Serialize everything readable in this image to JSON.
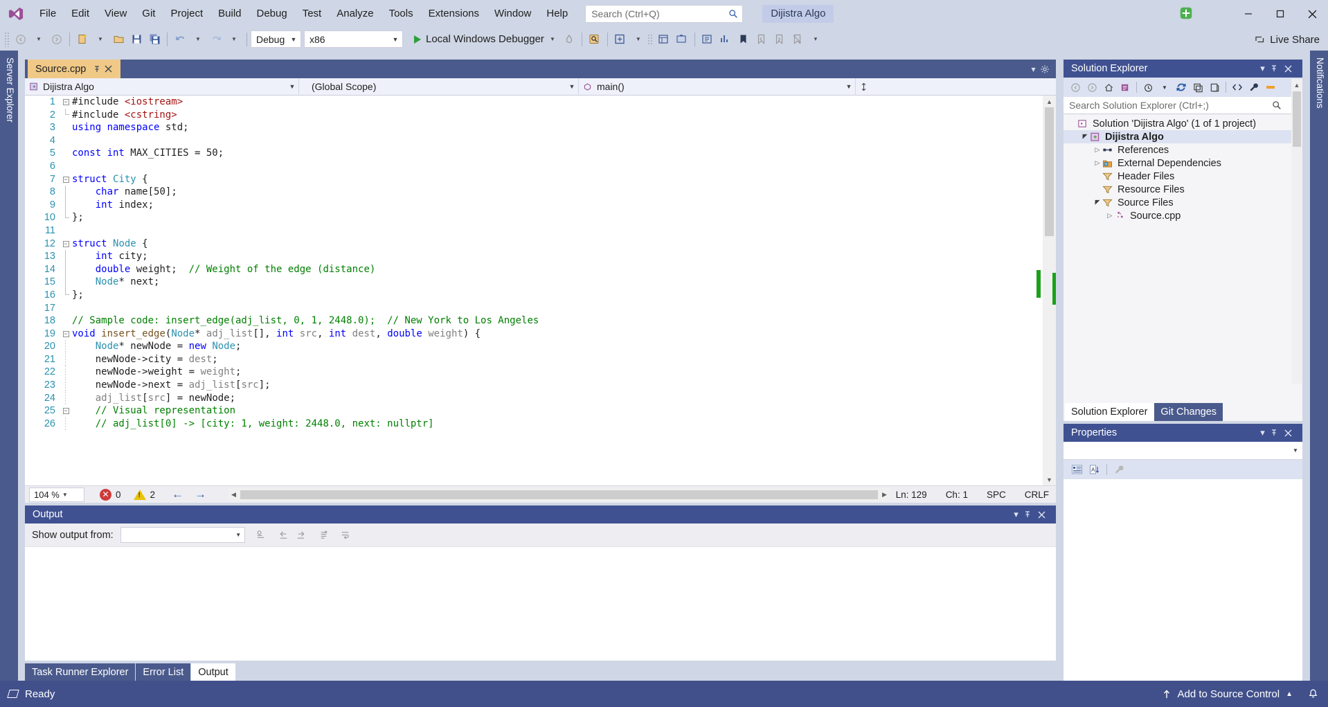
{
  "titlebar": {
    "logo_icon": "visual-studio-logo",
    "menu": [
      "File",
      "Edit",
      "View",
      "Git",
      "Project",
      "Build",
      "Debug",
      "Test",
      "Analyze",
      "Tools",
      "Extensions",
      "Window",
      "Help"
    ],
    "search_placeholder": "Search (Ctrl+Q)",
    "search_icon": "search-icon",
    "project_chip": "Dijistra Algo",
    "minimize_icon": "minimize-icon",
    "maximize_icon": "maximize-icon",
    "close_icon": "close-icon"
  },
  "toolbar": {
    "back_icon": "navigate-back-icon",
    "forward_icon": "navigate-forward-icon",
    "new_project_icon": "new-project-icon",
    "open_icon": "open-file-icon",
    "save_icon": "save-icon",
    "save_all_icon": "save-all-icon",
    "undo_icon": "undo-icon",
    "redo_icon": "redo-icon",
    "config_value": "Debug",
    "platform_value": "x86",
    "run_label": "Local Windows Debugger",
    "run_icon": "play-icon",
    "hot_reload_icon": "hot-reload-icon",
    "find_icon": "find-in-files-icon",
    "live_share_label": "Live Share",
    "live_share_icon": "live-share-icon"
  },
  "left_rail": {
    "label": "Server Explorer"
  },
  "right_rail": {
    "label": "Notifications"
  },
  "editor": {
    "tab_title": "Source.cpp",
    "pin_icon": "pin-icon",
    "close_icon": "close-icon",
    "nav_project": "Dijistra Algo",
    "nav_scope": "(Global Scope)",
    "nav_member": "main()",
    "nav_member_icon": "method-icon",
    "nav_project_icon": "cpp-project-icon",
    "lines": [
      {
        "n": 1,
        "fold": "minus",
        "indent": 0,
        "tokens": [
          {
            "t": "#include ",
            "c": "pp"
          },
          {
            "t": "<iostream>",
            "c": "str"
          }
        ]
      },
      {
        "n": 2,
        "fold": "end",
        "indent": 0,
        "tokens": [
          {
            "t": "#include ",
            "c": "pp"
          },
          {
            "t": "<cstring>",
            "c": "str"
          }
        ]
      },
      {
        "n": 3,
        "fold": "none",
        "indent": 0,
        "tokens": [
          {
            "t": "using ",
            "c": "kw"
          },
          {
            "t": "namespace ",
            "c": "kw"
          },
          {
            "t": "std;",
            "c": "num"
          }
        ]
      },
      {
        "n": 4,
        "fold": "none",
        "indent": 0,
        "tokens": []
      },
      {
        "n": 5,
        "fold": "none",
        "indent": 0,
        "tokens": [
          {
            "t": "const ",
            "c": "kw"
          },
          {
            "t": "int ",
            "c": "kw"
          },
          {
            "t": "MAX_CITIES = ",
            "c": "num"
          },
          {
            "t": "50",
            "c": "num"
          },
          {
            "t": ";",
            "c": "num"
          }
        ]
      },
      {
        "n": 6,
        "fold": "none",
        "indent": 0,
        "tokens": []
      },
      {
        "n": 7,
        "fold": "minus",
        "indent": 0,
        "tokens": [
          {
            "t": "struct ",
            "c": "kw"
          },
          {
            "t": "City",
            "c": "typ"
          },
          {
            "t": " {",
            "c": "num"
          }
        ]
      },
      {
        "n": 8,
        "fold": "bar",
        "indent": 0,
        "tokens": [
          {
            "t": "    ",
            "c": "num"
          },
          {
            "t": "char ",
            "c": "kw"
          },
          {
            "t": "name[",
            "c": "num"
          },
          {
            "t": "50",
            "c": "num"
          },
          {
            "t": "];",
            "c": "num"
          }
        ]
      },
      {
        "n": 9,
        "fold": "bar",
        "indent": 0,
        "tokens": [
          {
            "t": "    ",
            "c": "num"
          },
          {
            "t": "int ",
            "c": "kw"
          },
          {
            "t": "index;",
            "c": "num"
          }
        ]
      },
      {
        "n": 10,
        "fold": "endbar",
        "indent": 0,
        "tokens": [
          {
            "t": "};",
            "c": "num"
          }
        ]
      },
      {
        "n": 11,
        "fold": "none",
        "indent": 0,
        "tokens": []
      },
      {
        "n": 12,
        "fold": "minus",
        "indent": 0,
        "tokens": [
          {
            "t": "struct ",
            "c": "kw"
          },
          {
            "t": "Node",
            "c": "typ"
          },
          {
            "t": " {",
            "c": "num"
          }
        ]
      },
      {
        "n": 13,
        "fold": "bar",
        "indent": 0,
        "tokens": [
          {
            "t": "    ",
            "c": "num"
          },
          {
            "t": "int ",
            "c": "kw"
          },
          {
            "t": "city;",
            "c": "num"
          }
        ]
      },
      {
        "n": 14,
        "fold": "bar",
        "indent": 0,
        "tokens": [
          {
            "t": "    ",
            "c": "num"
          },
          {
            "t": "double ",
            "c": "kw"
          },
          {
            "t": "weight;  ",
            "c": "num"
          },
          {
            "t": "// Weight of the edge (distance)",
            "c": "cmt"
          }
        ]
      },
      {
        "n": 15,
        "fold": "bar",
        "indent": 0,
        "tokens": [
          {
            "t": "    ",
            "c": "num"
          },
          {
            "t": "Node",
            "c": "typ"
          },
          {
            "t": "* next;",
            "c": "num"
          }
        ]
      },
      {
        "n": 16,
        "fold": "endbar",
        "indent": 0,
        "tokens": [
          {
            "t": "};",
            "c": "num"
          }
        ]
      },
      {
        "n": 17,
        "fold": "none",
        "indent": 0,
        "tokens": []
      },
      {
        "n": 18,
        "fold": "none",
        "indent": 0,
        "tokens": [
          {
            "t": "// Sample code: insert_edge(adj_list, 0, 1, 2448.0);  // New York to Los Angeles",
            "c": "cmt"
          }
        ]
      },
      {
        "n": 19,
        "fold": "minus",
        "indent": 0,
        "tokens": [
          {
            "t": "void ",
            "c": "kw"
          },
          {
            "t": "insert_edge",
            "c": "fn"
          },
          {
            "t": "(",
            "c": "num"
          },
          {
            "t": "Node",
            "c": "typ"
          },
          {
            "t": "* ",
            "c": "num"
          },
          {
            "t": "adj_list",
            "c": "var"
          },
          {
            "t": "[], ",
            "c": "num"
          },
          {
            "t": "int ",
            "c": "kw"
          },
          {
            "t": "src",
            "c": "var"
          },
          {
            "t": ", ",
            "c": "num"
          },
          {
            "t": "int ",
            "c": "kw"
          },
          {
            "t": "dest",
            "c": "var"
          },
          {
            "t": ", ",
            "c": "num"
          },
          {
            "t": "double ",
            "c": "kw"
          },
          {
            "t": "weight",
            "c": "var"
          },
          {
            "t": ") {",
            "c": "num"
          }
        ]
      },
      {
        "n": 20,
        "fold": "ibar",
        "indent": 0,
        "tokens": [
          {
            "t": "    ",
            "c": "num"
          },
          {
            "t": "Node",
            "c": "typ"
          },
          {
            "t": "* newNode = ",
            "c": "num"
          },
          {
            "t": "new ",
            "c": "kw"
          },
          {
            "t": "Node",
            "c": "typ"
          },
          {
            "t": ";",
            "c": "num"
          }
        ]
      },
      {
        "n": 21,
        "fold": "ibar",
        "indent": 0,
        "tokens": [
          {
            "t": "    newNode->city = ",
            "c": "num"
          },
          {
            "t": "dest",
            "c": "var"
          },
          {
            "t": ";",
            "c": "num"
          }
        ]
      },
      {
        "n": 22,
        "fold": "ibar",
        "indent": 0,
        "tokens": [
          {
            "t": "    newNode->weight = ",
            "c": "num"
          },
          {
            "t": "weight",
            "c": "var"
          },
          {
            "t": ";",
            "c": "num"
          }
        ]
      },
      {
        "n": 23,
        "fold": "ibar",
        "indent": 0,
        "tokens": [
          {
            "t": "    newNode->next = ",
            "c": "num"
          },
          {
            "t": "adj_list",
            "c": "var"
          },
          {
            "t": "[",
            "c": "num"
          },
          {
            "t": "src",
            "c": "var"
          },
          {
            "t": "];",
            "c": "num"
          }
        ]
      },
      {
        "n": 24,
        "fold": "ibar",
        "indent": 0,
        "tokens": [
          {
            "t": "    ",
            "c": "num"
          },
          {
            "t": "adj_list",
            "c": "var"
          },
          {
            "t": "[",
            "c": "num"
          },
          {
            "t": "src",
            "c": "var"
          },
          {
            "t": "] = newNode;",
            "c": "num"
          }
        ]
      },
      {
        "n": 25,
        "fold": "minus2",
        "indent": 0,
        "tokens": [
          {
            "t": "    ",
            "c": "num"
          },
          {
            "t": "// Visual representation",
            "c": "cmt"
          }
        ]
      },
      {
        "n": 26,
        "fold": "ibar",
        "indent": 0,
        "tokens": [
          {
            "t": "    ",
            "c": "num"
          },
          {
            "t": "// adj_list[0] -> [city: 1, weight: 2448.0, next: nullptr]",
            "c": "cmt"
          }
        ]
      }
    ],
    "status": {
      "zoom": "104 %",
      "errors": "0",
      "warnings": "2",
      "error_icon": "error-icon",
      "warning_icon": "warning-icon",
      "prev_icon": "previous-error-icon",
      "next_icon": "next-error-icon",
      "line": "Ln: 129",
      "col": "Ch: 1",
      "spaces": "SPC",
      "eol": "CRLF"
    }
  },
  "output_panel": {
    "title": "Output",
    "show_from_label": "Show output from:",
    "show_from_value": "",
    "dropdown_icon": "chevron-down-icon",
    "find_icon": "find-message-icon",
    "prev_icon": "go-to-previous-icon",
    "next_icon": "go-to-next-icon",
    "clear_icon": "clear-all-icon",
    "wrap_icon": "toggle-word-wrap-icon",
    "minimize_icon": "window-menu-icon",
    "pin_icon": "pin-icon",
    "close_icon": "close-icon"
  },
  "bottom_tabs": [
    {
      "label": "Task Runner Explorer",
      "active": false
    },
    {
      "label": "Error List",
      "active": false
    },
    {
      "label": "Output",
      "active": true
    }
  ],
  "solution_explorer": {
    "title": "Solution Explorer",
    "menu_icon": "window-menu-icon",
    "pin_icon": "pin-icon",
    "close_icon": "close-icon",
    "toolbar_icons": [
      "back-icon",
      "forward-icon",
      "home-icon",
      "pending-changes-icon",
      "history-icon",
      "refresh-icon",
      "collapse-all-icon",
      "show-all-files-icon",
      "view-code-icon",
      "properties-icon",
      "preview-icon"
    ],
    "search_placeholder": "Search Solution Explorer (Ctrl+;)",
    "search_icon": "search-icon",
    "filter_icon": "filter-icon",
    "tree": [
      {
        "label": "Solution 'Dijistra Algo' (1 of 1 project)",
        "indent": 0,
        "twisty": "none",
        "icon": "solution-icon",
        "bold": false,
        "selected": false
      },
      {
        "label": "Dijistra Algo",
        "indent": 1,
        "twisty": "open",
        "icon": "cpp-project-icon",
        "bold": true,
        "selected": true
      },
      {
        "label": "References",
        "indent": 2,
        "twisty": "closed",
        "icon": "references-icon",
        "bold": false,
        "selected": false
      },
      {
        "label": "External Dependencies",
        "indent": 2,
        "twisty": "closed",
        "icon": "dependencies-icon",
        "bold": false,
        "selected": false
      },
      {
        "label": "Header Files",
        "indent": 2,
        "twisty": "none",
        "icon": "filter-folder-icon",
        "bold": false,
        "selected": false
      },
      {
        "label": "Resource Files",
        "indent": 2,
        "twisty": "none",
        "icon": "filter-folder-icon",
        "bold": false,
        "selected": false
      },
      {
        "label": "Source Files",
        "indent": 2,
        "twisty": "open",
        "icon": "filter-folder-icon",
        "bold": false,
        "selected": false
      },
      {
        "label": "Source.cpp",
        "indent": 3,
        "twisty": "closed",
        "icon": "cpp-file-icon",
        "bold": false,
        "selected": false
      }
    ],
    "tabs": [
      {
        "label": "Solution Explorer",
        "active": true
      },
      {
        "label": "Git Changes",
        "active": false
      }
    ]
  },
  "properties_panel": {
    "title": "Properties",
    "menu_icon": "window-menu-icon",
    "pin_icon": "pin-icon",
    "close_icon": "close-icon",
    "object_value": "",
    "dropdown_icon": "chevron-down-icon",
    "categorized_icon": "categorized-view-icon",
    "alphabetical_icon": "alphabetical-view-icon",
    "properties_icon": "properties-wrench-icon"
  },
  "statusbar": {
    "ready": "Ready",
    "ready_icon": "ready-flag-icon",
    "source_control": "Add to Source Control",
    "upload_icon": "upload-arrow-icon",
    "expand_icon": "chevron-up-icon",
    "bell_icon": "notification-bell-icon"
  },
  "colors": {
    "chrome": "#CFD6E5",
    "accent_dark": "#41508B",
    "panel_header": "#3F5191",
    "tab_active": "#F0C987",
    "keyword": "#0000FF",
    "type": "#2B91AF",
    "comment": "#008000",
    "string": "#A31515",
    "linenum": "#2B91AF"
  }
}
